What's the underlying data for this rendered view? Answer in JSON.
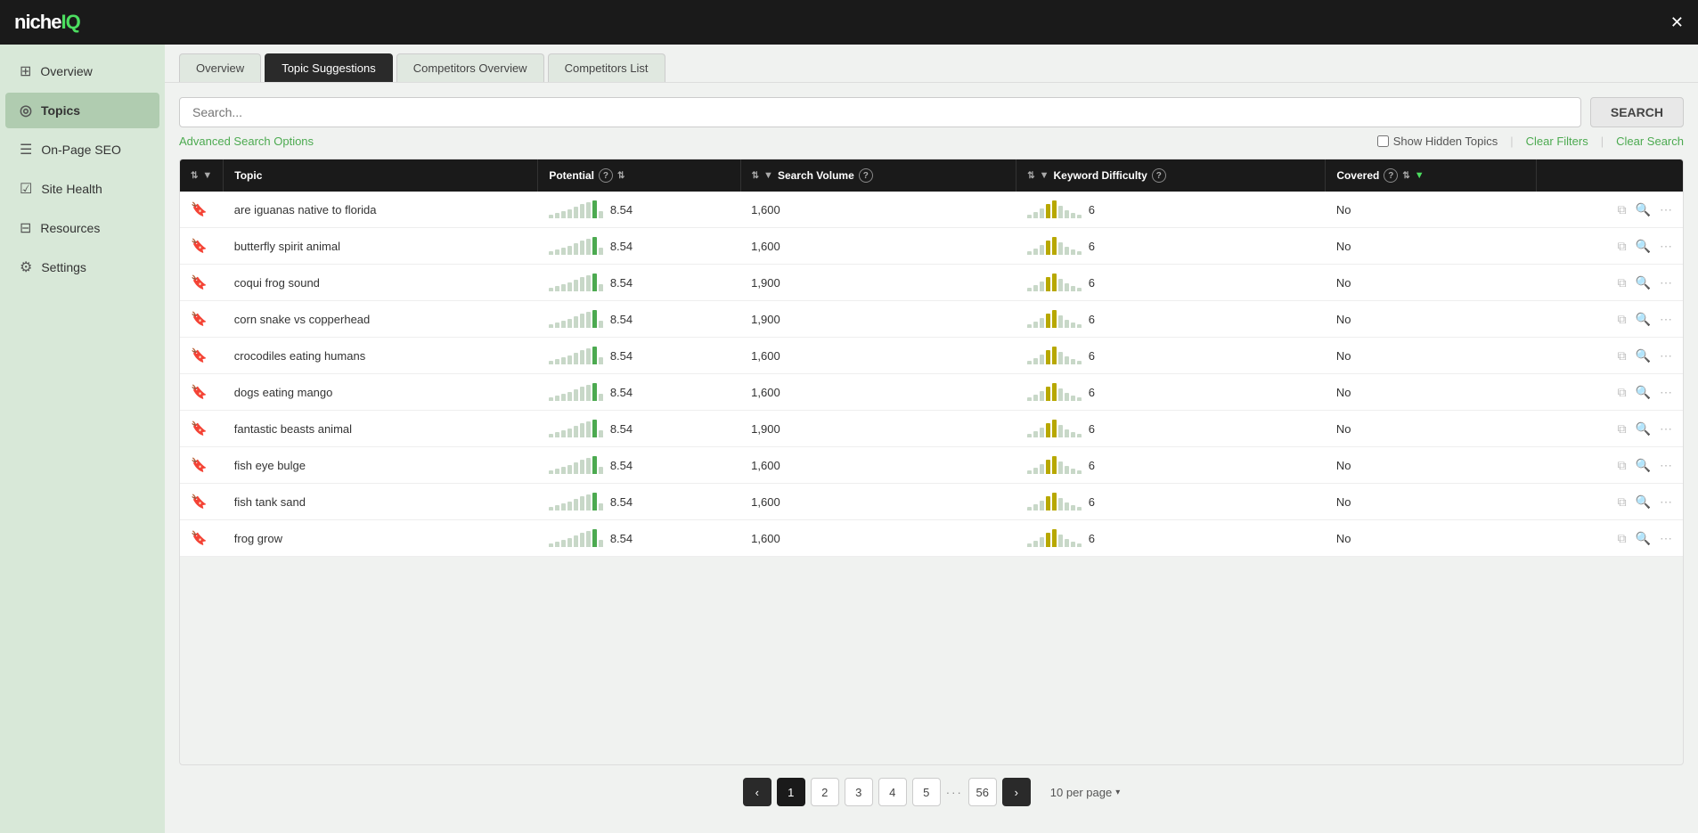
{
  "app": {
    "logo_text": "niche",
    "logo_accent": "IQ"
  },
  "sidebar": {
    "items": [
      {
        "id": "overview",
        "label": "Overview",
        "icon": "⊞"
      },
      {
        "id": "topics",
        "label": "Topics",
        "icon": "◎",
        "active": true
      },
      {
        "id": "on-page-seo",
        "label": "On-Page SEO",
        "icon": "☰"
      },
      {
        "id": "site-health",
        "label": "Site Health",
        "icon": "☑"
      },
      {
        "id": "resources",
        "label": "Resources",
        "icon": "⊟"
      },
      {
        "id": "settings",
        "label": "Settings",
        "icon": "⚙"
      }
    ]
  },
  "tabs": [
    {
      "id": "overview",
      "label": "Overview"
    },
    {
      "id": "topic-suggestions",
      "label": "Topic Suggestions",
      "active": true
    },
    {
      "id": "competitors-overview",
      "label": "Competitors Overview"
    },
    {
      "id": "competitors-list",
      "label": "Competitors List"
    }
  ],
  "search": {
    "placeholder": "Search...",
    "button_label": "SEARCH",
    "advanced_label": "Advanced Search Options",
    "show_hidden_label": "Show Hidden Topics",
    "clear_filters_label": "Clear Filters",
    "clear_search_label": "Clear Search"
  },
  "table": {
    "headers": [
      {
        "id": "topic",
        "label": "Topic"
      },
      {
        "id": "potential",
        "label": "Potential"
      },
      {
        "id": "search-volume",
        "label": "Search Volume"
      },
      {
        "id": "keyword-difficulty",
        "label": "Keyword Difficulty"
      },
      {
        "id": "covered",
        "label": "Covered"
      }
    ],
    "rows": [
      {
        "topic": "are iguanas native to florida",
        "potential": "8.54",
        "search_volume": "1,600",
        "kd": "6",
        "covered": "No"
      },
      {
        "topic": "butterfly spirit animal",
        "potential": "8.54",
        "search_volume": "1,600",
        "kd": "6",
        "covered": "No"
      },
      {
        "topic": "coqui frog sound",
        "potential": "8.54",
        "search_volume": "1,900",
        "kd": "6",
        "covered": "No"
      },
      {
        "topic": "corn snake vs copperhead",
        "potential": "8.54",
        "search_volume": "1,900",
        "kd": "6",
        "covered": "No"
      },
      {
        "topic": "crocodiles eating humans",
        "potential": "8.54",
        "search_volume": "1,600",
        "kd": "6",
        "covered": "No"
      },
      {
        "topic": "dogs eating mango",
        "potential": "8.54",
        "search_volume": "1,600",
        "kd": "6",
        "covered": "No"
      },
      {
        "topic": "fantastic beasts animal",
        "potential": "8.54",
        "search_volume": "1,900",
        "kd": "6",
        "covered": "No"
      },
      {
        "topic": "fish eye bulge",
        "potential": "8.54",
        "search_volume": "1,600",
        "kd": "6",
        "covered": "No"
      },
      {
        "topic": "fish tank sand",
        "potential": "8.54",
        "search_volume": "1,600",
        "kd": "6",
        "covered": "No"
      },
      {
        "topic": "frog grow",
        "potential": "8.54",
        "search_volume": "1,600",
        "kd": "6",
        "covered": "No"
      }
    ]
  },
  "pagination": {
    "prev_label": "‹",
    "next_label": "›",
    "pages": [
      "1",
      "2",
      "3",
      "4",
      "5"
    ],
    "last_page": "56",
    "current_page": "1",
    "per_page_label": "10 per page"
  }
}
